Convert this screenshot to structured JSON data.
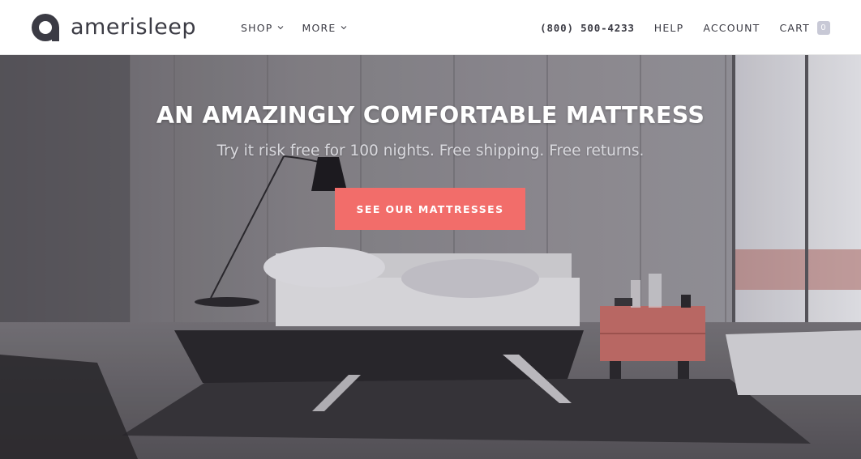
{
  "brand": {
    "name": "amerisleep"
  },
  "nav": {
    "shop": "SHOP",
    "more": "MORE",
    "phone": "(800) 500-4233",
    "help": "HELP",
    "account": "ACCOUNT",
    "cart": "CART",
    "cart_count": "0"
  },
  "hero": {
    "title": "AN AMAZINGLY COMFORTABLE MATTRESS",
    "subtitle": "Try it risk free for 100 nights. Free shipping. Free returns.",
    "cta": "SEE OUR MATTRESSES"
  },
  "colors": {
    "accent": "#f26d6a",
    "text_dark": "#3b3b44",
    "badge": "#c8c9d6"
  }
}
